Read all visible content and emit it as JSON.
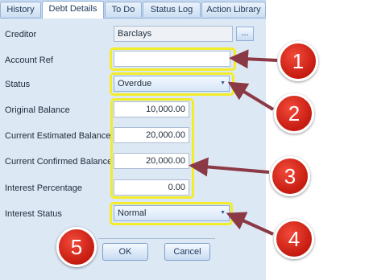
{
  "tabs": [
    {
      "label": "History"
    },
    {
      "label": "Debt Details"
    },
    {
      "label": "To Do"
    },
    {
      "label": "Status Log"
    },
    {
      "label": "Action Library"
    }
  ],
  "active_tab": "Debt Details",
  "form": {
    "creditor": {
      "label": "Creditor",
      "value": "Barclays",
      "button_label": "..."
    },
    "account_ref": {
      "label": "Account Ref",
      "value": ""
    },
    "status": {
      "label": "Status",
      "value": "Overdue"
    },
    "original_balance": {
      "label": "Original Balance",
      "value": "10,000.00"
    },
    "current_estimated_balance": {
      "label": "Current Estimated Balance",
      "value": "20,000.00"
    },
    "current_confirmed_balance": {
      "label": "Current Confirmed Balance",
      "value": "20,000.00"
    },
    "interest_percentage": {
      "label": "Interest Percentage",
      "value": "0.00"
    },
    "interest_status": {
      "label": "Interest Status",
      "value": "Normal"
    }
  },
  "buttons": {
    "ok": "OK",
    "cancel": "Cancel"
  },
  "callouts": [
    "1",
    "2",
    "3",
    "4",
    "5"
  ],
  "colors": {
    "highlight": "#f2ec2a",
    "callout": "#d42a1c",
    "arrow": "#8b3a45"
  }
}
